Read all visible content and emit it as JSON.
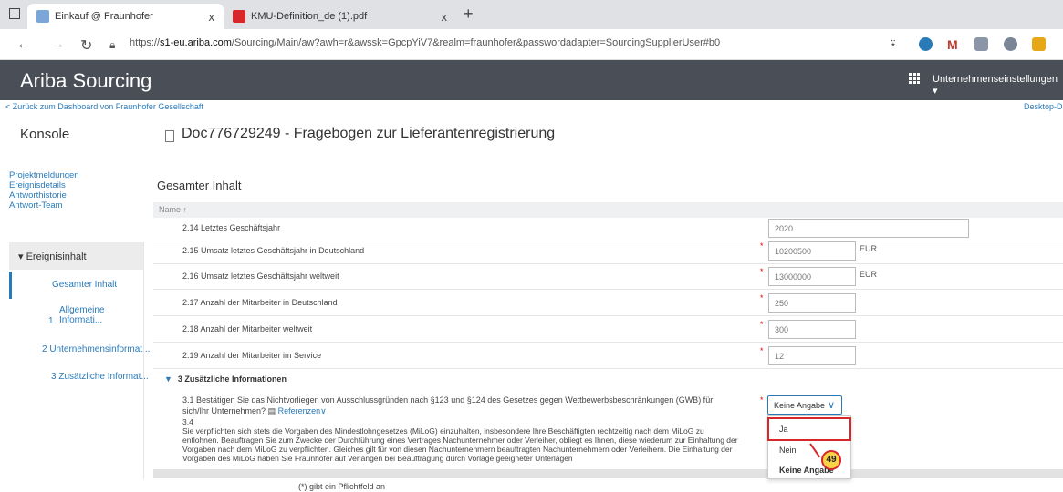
{
  "browser": {
    "tabs": [
      {
        "label": "Einkauf @ Fraunhofer",
        "close": "x"
      },
      {
        "label": "KMU-Definition_de (1).pdf",
        "close": "x"
      }
    ],
    "new_tab": "+",
    "url_prefix": "https://",
    "url_host": "s1-eu.ariba.com",
    "url_path": "/Sourcing/Main/aw?awh=r&awssk=GpcpYiV7&realm=fraunhofer&passwordadapter=SourcingSupplierUser#b0"
  },
  "header": {
    "brand": "Ariba Sourcing",
    "company_menu": "Unternehmenseinstellungen ▾"
  },
  "back_link": "< Zurück zum Dashboard von Fraunhofer Gesellschaft",
  "desktop_link": "Desktop-Da",
  "konsole": "Konsole",
  "doc_title": "Doc776729249 - Fragebogen zur Lieferantenregistrierung",
  "sidebar": {
    "links": [
      "Projektmeldungen",
      "Ereignisdetails",
      "Antworthistorie",
      "Antwort-Team"
    ],
    "section": "▾ Ereignisinhalt",
    "active_item": "Gesamter Inhalt",
    "item1_num": "1",
    "item1_line1": "Allgemeine",
    "item1_line2": "Informati...",
    "item2": "2  Unternehmensinformat...",
    "item3": "3  Zusätzliche Informat..."
  },
  "main": {
    "heading": "Gesamter Inhalt",
    "column_name": "Name ↑",
    "rows": [
      {
        "label": "2.14  Letztes Geschäftsjahr",
        "value": "2020",
        "currency": "",
        "required": false
      },
      {
        "label": "2.15  Umsatz letztes Geschäftsjahr in Deutschland",
        "value": "10200500",
        "currency": "EUR",
        "required": true
      },
      {
        "label": "2.16  Umsatz letztes Geschäftsjahr weltweit",
        "value": "13000000",
        "currency": "EUR",
        "required": true
      },
      {
        "label": "2.17  Anzahl der Mitarbeiter in Deutschland",
        "value": "250",
        "currency": "",
        "required": true
      },
      {
        "label": "2.18  Anzahl der Mitarbeiter weltweit",
        "value": "300",
        "currency": "",
        "required": true
      },
      {
        "label": "2.19  Anzahl der Mitarbeiter im Service",
        "value": "12",
        "currency": "",
        "required": true
      }
    ],
    "section3": "3  Zusätzliche Informationen",
    "q31": "3.1  Bestätigen Sie das Nichtvorliegen von Ausschlussgründen nach §123 und §124 des Gesetzes gegen Wettbewerbsbeschränkungen (GWB) für sich/Ihr Unternehmen?",
    "q31_ref": "Referenzen",
    "q31_select": "Keine Angabe",
    "q34_num": "3.4",
    "q34_text": "Sie verpflichten sich stets die Vorgaben des Mindestlohngesetzes (MiLoG) einzuhalten, insbesondere Ihre Beschäftigten rechtzeitig nach dem MiLoG zu entlohnen. Beauftragen Sie zum Zwecke der Durchführung eines Vertrages Nachunternehmer oder Verleiher, obliegt es Ihnen, diese wiederum zur Einhaltung der Vorgaben nach dem MiLoG zu verpflichten. Gleiches gilt für von diesen Nachunternehmern beauftragten Nachunternehmern oder Verleihern. Die Einhaltung der Vorgaben des MiLoG haben Sie Fraunhofer auf Verlangen bei Beauftragung durch Vorlage geeigneter Unterlagen",
    "required_note": "(*) gibt ein Pflichtfeld an"
  },
  "dropdown": {
    "options": [
      "Ja",
      "Nein",
      "Keine Angabe"
    ]
  },
  "annotation": {
    "step": "49"
  },
  "colors": {
    "header_bg": "#4a4e57",
    "link": "#2a7ab8",
    "highlight": "#d9262b",
    "marker": "#f8d247"
  }
}
